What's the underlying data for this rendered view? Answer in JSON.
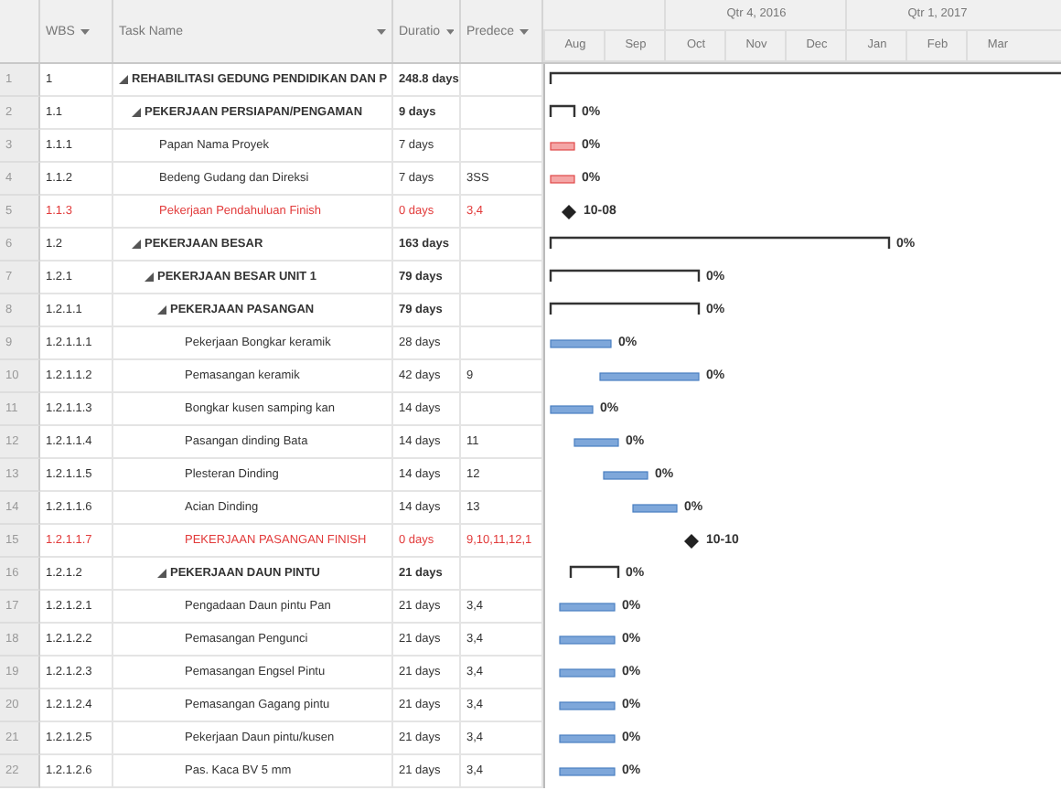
{
  "columns": [
    {
      "label": "WBS"
    },
    {
      "label": "Task Name"
    },
    {
      "label": "Duratio"
    },
    {
      "label": "Predece"
    }
  ],
  "timescale": {
    "quarters": [
      "Qtr 4, 2016",
      "Qtr 1, 2017"
    ],
    "months": [
      "Aug",
      "Sep",
      "Oct",
      "Nov",
      "Dec",
      "Jan",
      "Feb",
      "Mar"
    ]
  },
  "tasks": [
    {
      "row": "1",
      "wbs": "1",
      "name": "REHABILITASI GEDUNG PENDIDIKAN DAN P",
      "duration": "248.8 days",
      "kind": "summary",
      "expanded": true,
      "children": [
        {
          "row": "2",
          "wbs": "1.1",
          "name": "PEKERJAAN PERSIAPAN/PENGAMAN",
          "duration": "9 days",
          "kind": "summary",
          "expanded": true,
          "bar_label": "0%",
          "children": [
            {
              "row": "3",
              "wbs": "1.1.1",
              "name": "Papan Nama Proyek",
              "duration": "7 days",
              "kind": "task",
              "critical": true,
              "bar_label": "0%"
            },
            {
              "row": "4",
              "wbs": "1.1.2",
              "name": "Bedeng Gudang dan Direksi",
              "duration": "7 days",
              "predecessors": "3SS",
              "kind": "task",
              "critical": true,
              "bar_label": "0%"
            },
            {
              "row": "5",
              "wbs": "1.1.3",
              "name": "Pekerjaan Pendahuluan Finish",
              "duration": "0 days",
              "predecessors": "3,4",
              "kind": "milestone",
              "critical": true,
              "bar_label": "10-08"
            }
          ]
        },
        {
          "row": "6",
          "wbs": "1.2",
          "name": "PEKERJAAN BESAR",
          "duration": "163 days",
          "kind": "summary",
          "expanded": true,
          "bar_label": "0%",
          "children": [
            {
              "row": "7",
              "wbs": "1.2.1",
              "name": "PEKERJAAN BESAR UNIT 1",
              "duration": "79 days",
              "kind": "summary",
              "expanded": true,
              "bar_label": "0%",
              "children": [
                {
                  "row": "8",
                  "wbs": "1.2.1.1",
                  "name": "PEKERJAAN PASANGAN",
                  "duration": "79 days",
                  "kind": "summary",
                  "expanded": true,
                  "bar_label": "0%",
                  "children": [
                    {
                      "row": "9",
                      "wbs": "1.2.1.1.1",
                      "name": "Pekerjaan Bongkar keramik",
                      "duration": "28 days",
                      "kind": "task",
                      "critical": false,
                      "bar_label": "0%"
                    },
                    {
                      "row": "10",
                      "wbs": "1.2.1.1.2",
                      "name": "Pemasangan keramik",
                      "duration": "42 days",
                      "predecessors": "9",
                      "kind": "task",
                      "critical": false,
                      "bar_label": "0%"
                    },
                    {
                      "row": "11",
                      "wbs": "1.2.1.1.3",
                      "name": "Bongkar kusen samping kan",
                      "duration": "14 days",
                      "kind": "task",
                      "critical": false,
                      "bar_label": "0%"
                    },
                    {
                      "row": "12",
                      "wbs": "1.2.1.1.4",
                      "name": "Pasangan dinding Bata",
                      "duration": "14 days",
                      "predecessors": "11",
                      "kind": "task",
                      "critical": false,
                      "bar_label": "0%"
                    },
                    {
                      "row": "13",
                      "wbs": "1.2.1.1.5",
                      "name": "Plesteran Dinding",
                      "duration": "14 days",
                      "predecessors": "12",
                      "kind": "task",
                      "critical": false,
                      "bar_label": "0%"
                    },
                    {
                      "row": "14",
                      "wbs": "1.2.1.1.6",
                      "name": "Acian Dinding",
                      "duration": "14 days",
                      "predecessors": "13",
                      "kind": "task",
                      "critical": false,
                      "bar_label": "0%"
                    },
                    {
                      "row": "15",
                      "wbs": "1.2.1.1.7",
                      "name": "PEKERJAAN PASANGAN FINISH",
                      "duration": "0 days",
                      "predecessors": "9,10,11,12,1",
                      "kind": "milestone",
                      "critical": true,
                      "bar_label": "10-10"
                    }
                  ]
                },
                {
                  "row": "16",
                  "wbs": "1.2.1.2",
                  "name": "PEKERJAAN DAUN PINTU",
                  "duration": "21 days",
                  "kind": "summary",
                  "expanded": true,
                  "bar_label": "0%",
                  "children": [
                    {
                      "row": "17",
                      "wbs": "1.2.1.2.1",
                      "name": "Pengadaan Daun pintu Pan",
                      "duration": "21 days",
                      "predecessors": "3,4",
                      "kind": "task",
                      "critical": false,
                      "bar_label": "0%"
                    },
                    {
                      "row": "18",
                      "wbs": "1.2.1.2.2",
                      "name": "Pemasangan Pengunci",
                      "duration": "21 days",
                      "predecessors": "3,4",
                      "kind": "task",
                      "critical": false,
                      "bar_label": "0%"
                    },
                    {
                      "row": "19",
                      "wbs": "1.2.1.2.3",
                      "name": "Pemasangan Engsel Pintu",
                      "duration": "21 days",
                      "predecessors": "3,4",
                      "kind": "task",
                      "critical": false,
                      "bar_label": "0%"
                    },
                    {
                      "row": "20",
                      "wbs": "1.2.1.2.4",
                      "name": "Pemasangan Gagang pintu",
                      "duration": "21 days",
                      "predecessors": "3,4",
                      "kind": "task",
                      "critical": false,
                      "bar_label": "0%"
                    },
                    {
                      "row": "21",
                      "wbs": "1.2.1.2.5",
                      "name": "Pekerjaan Daun pintu/kusen",
                      "duration": "21 days",
                      "predecessors": "3,4",
                      "kind": "task",
                      "critical": false,
                      "bar_label": "0%"
                    },
                    {
                      "row": "22",
                      "wbs": "1.2.1.2.6",
                      "name": "Pas. Kaca BV 5 mm",
                      "duration": "21 days",
                      "predecessors": "3,4",
                      "kind": "task",
                      "critical": false,
                      "bar_label": "0%"
                    }
                  ]
                }
              ]
            }
          ]
        }
      ]
    }
  ]
}
